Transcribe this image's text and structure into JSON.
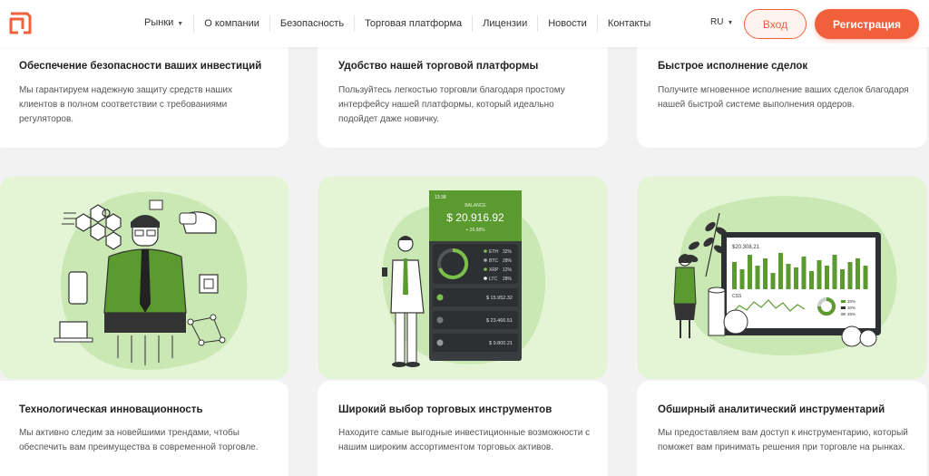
{
  "header": {
    "nav": [
      {
        "label": "Рынки",
        "dropdown": true
      },
      {
        "label": "О компании"
      },
      {
        "label": "Безопасность"
      },
      {
        "label": "Торговая платформа"
      },
      {
        "label": "Лицензии"
      },
      {
        "label": "Новости"
      },
      {
        "label": "Контакты"
      }
    ],
    "lang": "RU",
    "login_label": "Вход",
    "register_label": "Регистрация"
  },
  "colors": {
    "accent": "#f1603b",
    "green": "#5a9a2f",
    "light_green": "#e4f5d6"
  },
  "top_cards": [
    {
      "title": "Обеспечение безопасности ваших инвестиций",
      "text": "Мы гарантируем надежную защиту средств наших клиентов в полном соответствии с требованиями регуляторов."
    },
    {
      "title": "Удобство нашей торговой платформы",
      "text": "Пользуйтесь легкостью торговли благодаря простому интерфейсу нашей платформы, который идеально подойдет даже новичку."
    },
    {
      "title": "Быстрое исполнение сделок",
      "text": "Получите мгновенное исполнение ваших сделок благодаря нашей быстрой системе выполнения ордеров."
    }
  ],
  "phone": {
    "time": "13:38",
    "heading": "BALANCE",
    "balance": "$ 20.916.92",
    "change": "+ 26.58%",
    "assets": [
      {
        "name": "ETH",
        "pct": "32%"
      },
      {
        "name": "BTC",
        "pct": "28%"
      },
      {
        "name": "XRP",
        "pct": "12%"
      },
      {
        "name": "LTC",
        "pct": "28%"
      }
    ],
    "rows": [
      "$ 15.952.32",
      "$ 23.466.51",
      "$ 9.800.21"
    ]
  },
  "monitor": {
    "value": "$20.308,21",
    "sublabel": "CSS",
    "legend": [
      "20%",
      "30%",
      "25%"
    ]
  },
  "bottom_cards": [
    {
      "title": "Технологическая инновационность",
      "text": "Мы активно следим за новейшими трендами, чтобы обеспечить вам преимущества в современной торговле."
    },
    {
      "title": "Широкий выбор торговых инструментов",
      "text": "Находите самые выгодные инвестиционные возможности с нашим широким ассортиментом торговых активов."
    },
    {
      "title": "Обширный аналитический инструментарий",
      "text": "Мы предоставляем вам доступ к инструментарию, который поможет вам принимать решения при торговле на рынках."
    }
  ]
}
